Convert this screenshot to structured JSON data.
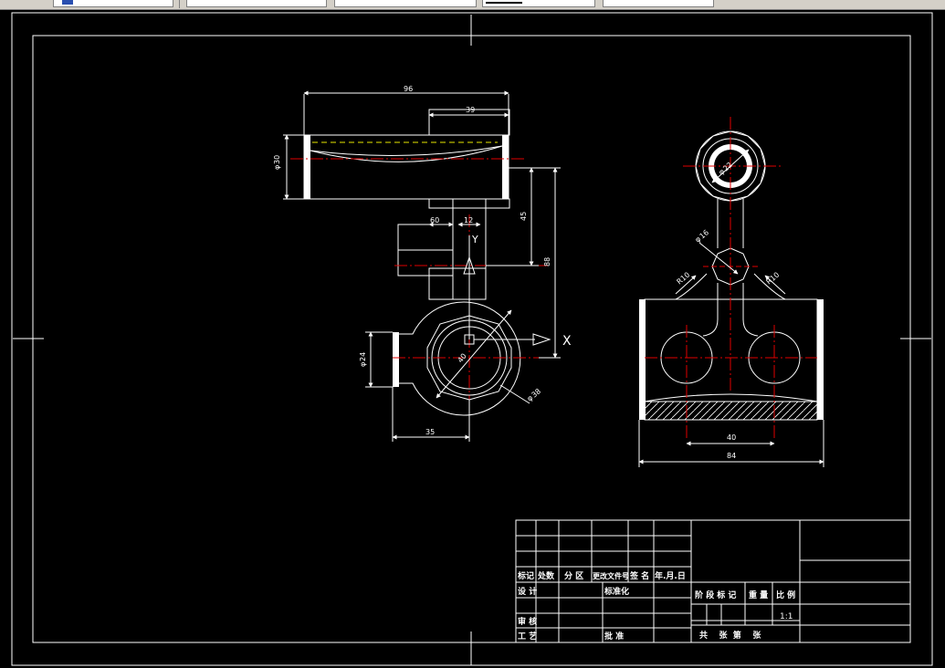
{
  "toolbar": {
    "combos": [
      {
        "name": "layer-combo",
        "value": ""
      },
      {
        "name": "style-combo",
        "value": ""
      },
      {
        "name": "linetype-combo",
        "value": ""
      },
      {
        "name": "color-combo",
        "value": ""
      }
    ]
  },
  "colors": {
    "background": "#000000",
    "outline": "#ffffff",
    "centerline": "#e00000",
    "hidden": "#e8e800"
  },
  "drawing": {
    "dims": {
      "d96": "96",
      "d39": "39",
      "d30": "30",
      "d60": "60",
      "d12": "12",
      "d45": "45",
      "d88": "88",
      "d24": "24",
      "d35": "35",
      "d40left": "40",
      "d38": "38",
      "d40": "40",
      "d84": "84",
      "d22": "22",
      "d16": "16",
      "r10a": "R10",
      "r10b": "R10"
    },
    "phi": "φ",
    "axis_y": "Y",
    "axis_x": "X"
  },
  "title_block": {
    "row_mark": [
      "标记",
      "处数",
      "分 区",
      "更改文件号",
      "签 名",
      "年.月.日"
    ],
    "design": "设 计",
    "standard": "标准化",
    "review": "审 核",
    "process": "工 艺",
    "approve": "批 准",
    "stage_mark": "阶 段 标 记",
    "weight": "重 量",
    "scale_label": "比 例",
    "scale_value": "1:1",
    "sheets": "共    张  第    张"
  }
}
